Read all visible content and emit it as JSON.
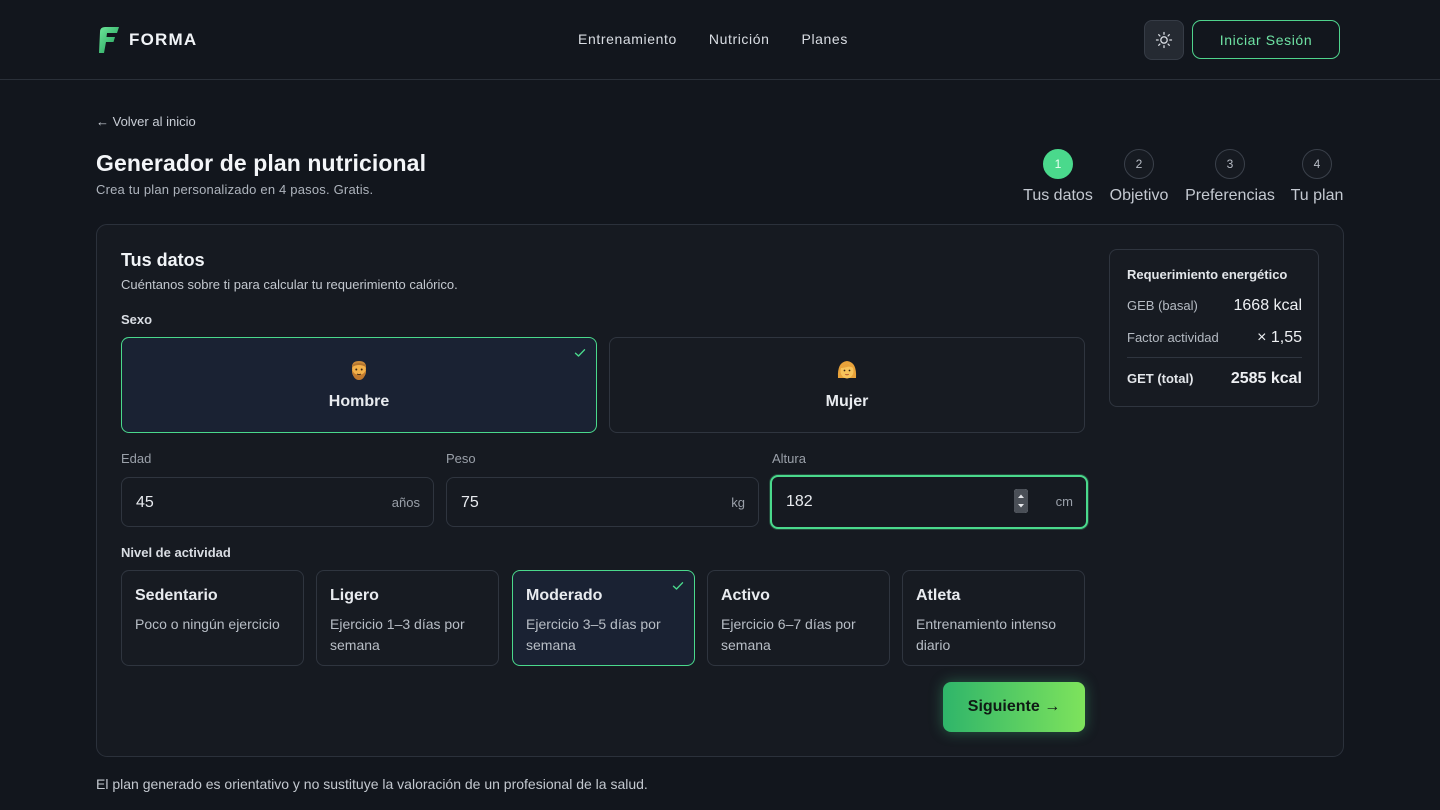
{
  "header": {
    "brand": "FORMA",
    "nav": [
      "Entrenamiento",
      "Nutrición",
      "Planes"
    ],
    "login_label": "Iniciar Sesión"
  },
  "page": {
    "back_label": "← Volver al inicio",
    "title": "Generador de plan nutricional",
    "subtitle": "Crea tu plan personalizado en 4 pasos. Gratis."
  },
  "stepper": {
    "current": 1,
    "steps": [
      {
        "number": "1",
        "label": "Tus datos"
      },
      {
        "number": "2",
        "label": "Objetivo"
      },
      {
        "number": "3",
        "label": "Preferencias"
      },
      {
        "number": "4",
        "label": "Tu plan"
      }
    ]
  },
  "form": {
    "title": "Tus datos",
    "subtitle": "Cuéntanos sobre ti para calcular tu requerimiento calórico.",
    "sex_label": "Sexo",
    "sex_options": [
      {
        "label": "Hombre",
        "selected": true
      },
      {
        "label": "Mujer",
        "selected": false
      }
    ],
    "age": {
      "label": "Edad",
      "value": "45",
      "unit": "años"
    },
    "weight": {
      "label": "Peso",
      "value": "75",
      "unit": "kg"
    },
    "height": {
      "label": "Altura",
      "value": "182",
      "unit": "cm"
    },
    "activity_label": "Nivel de actividad",
    "activity_options": [
      {
        "title": "Sedentario",
        "desc": "Poco o ningún ejercicio",
        "selected": false
      },
      {
        "title": "Ligero",
        "desc": "Ejercicio 1–3 días por semana",
        "selected": false
      },
      {
        "title": "Moderado",
        "desc": "Ejercicio 3–5 días por semana",
        "selected": true
      },
      {
        "title": "Activo",
        "desc": "Ejercicio 6–7 días por semana",
        "selected": false
      },
      {
        "title": "Atleta",
        "desc": "Entrenamiento intenso diario",
        "selected": false
      }
    ],
    "next_label": "Siguiente →"
  },
  "energy": {
    "title": "Requerimiento energético",
    "geb_label": "GEB (basal)",
    "geb_value": "1668 kcal",
    "factor_label": "Factor actividad",
    "factor_value": "× 1,55",
    "get_label": "GET (total)",
    "get_value": "2585 kcal"
  },
  "disclaimer": "El plan generado es orientativo y no sustituye la valoración de un profesional de la salud.",
  "colors": {
    "accent": "#4ad98c",
    "background": "#12161d",
    "card": "#161a21",
    "selected_bg": "#1a2233"
  }
}
